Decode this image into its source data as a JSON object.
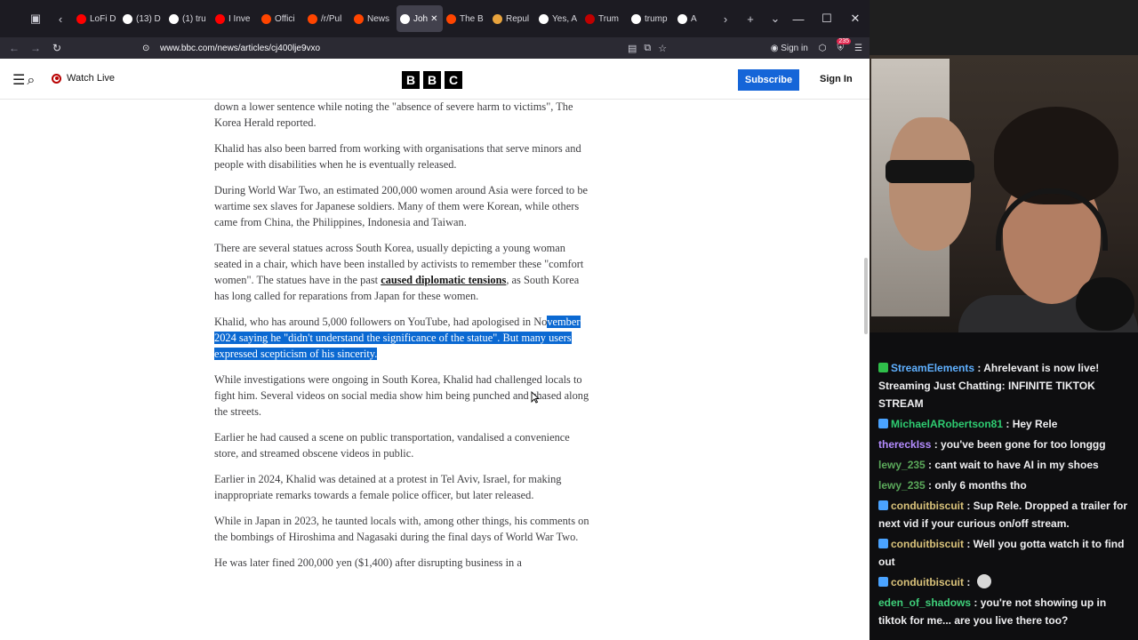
{
  "browser": {
    "tabs": [
      {
        "label": "LoFi D",
        "color": "#ff0000"
      },
      {
        "label": "(13) D",
        "color": "#ffffff"
      },
      {
        "label": "(1) tru",
        "color": "#ffffff"
      },
      {
        "label": "I Inve",
        "color": "#ff0000"
      },
      {
        "label": "Offici",
        "color": "#ff4500"
      },
      {
        "label": "/r/Pul",
        "color": "#ff4500"
      },
      {
        "label": "News",
        "color": "#ff4500"
      },
      {
        "label": "Joh",
        "color": "#ffffff",
        "active": true
      },
      {
        "label": "The B",
        "color": "#ff4500"
      },
      {
        "label": "Repul",
        "color": "#e8a33d"
      },
      {
        "label": "Yes, A",
        "color": "#ffffff"
      },
      {
        "label": "Trum",
        "color": "#c00000"
      },
      {
        "label": "trump",
        "color": "#ffffff"
      },
      {
        "label": "A",
        "color": "#ffffff"
      }
    ],
    "url": "www.bbc.com/news/articles/cj400lje9vxo",
    "signin_label": "Sign in",
    "extension_count": "235"
  },
  "bbc": {
    "watch_live": "Watch Live",
    "logo": [
      "B",
      "B",
      "C"
    ],
    "subscribe": "Subscribe",
    "sign_in": "Sign In"
  },
  "article": {
    "p1": "down a lower sentence while noting the \"absence of severe harm to victims\", The Korea Herald reported.",
    "p2": "Khalid has also been barred from working with organisations that serve minors and people with disabilities when he is eventually released.",
    "p3": "During World War Two, an estimated 200,000 women around Asia were forced to be wartime sex slaves for Japanese soldiers. Many of them were Korean, while others came from China, the Philippines, Indonesia and Taiwan.",
    "p4a": "There are several statues across South Korea, usually depicting a young woman seated in a chair, which have been installed by activists to remember these \"comfort women\". The statues have in the past ",
    "p4link": "caused diplomatic tensions",
    "p4b": ", as South Korea has long called for reparations from Japan for these women.",
    "p5a": "Khalid, who has around 5,000 followers on YouTube, had apologised in No",
    "p5hl": "vember 2024 saying he \"didn't understand the significance of the statue\". But many users expressed scepticism of his sincerity.",
    "p6": "While investigations were ongoing in South Korea, Khalid had challenged locals to fight him. Several videos on social media show him being punched and chased along the streets.",
    "p7": "Earlier he had caused a scene on public transportation, vandalised a convenience store, and streamed obscene videos in public.",
    "p8": "Earlier in 2024, Khalid was detained at a protest in Tel Aviv, Israel, for making inappropriate remarks towards a female police officer, but later released.",
    "p9": "While in Japan in 2023, he taunted locals with, among other things, his comments on the bombings of Hiroshima and Nagasaki during the final days of World War Two.",
    "p10": "He was later fined 200,000 yen ($1,400) after disrupting business in a"
  },
  "chat": [
    {
      "user": "StreamElements",
      "color": "#5fb0ff",
      "text": "Ahrelevant is now live! Streaming Just Chatting: INFINITE TIKTOK STREAM",
      "badge": "#2fbf4a"
    },
    {
      "user": "MichaelARobertson81",
      "color": "#2ecc71",
      "text": "Hey Rele",
      "badge": "#4aa3ff"
    },
    {
      "user": "thereckIss",
      "color": "#b48cff",
      "text": "you've been gone for too longgg",
      "badge": ""
    },
    {
      "user": "lewy_235",
      "color": "#5aa85a",
      "text": "cant wait to have AI in my shoes",
      "badge": ""
    },
    {
      "user": "lewy_235",
      "color": "#5aa85a",
      "text": "only 6 months tho",
      "badge": ""
    },
    {
      "user": "conduitbiscuit",
      "color": "#d9c27a",
      "text": "Sup Rele. Dropped a trailer for next vid if your curious on/off stream.",
      "badge": "#4aa3ff"
    },
    {
      "user": "conduitbiscuit",
      "color": "#d9c27a",
      "text": "Well you gotta watch it to find out",
      "badge": "#4aa3ff"
    },
    {
      "user": "conduitbiscuit",
      "color": "#d9c27a",
      "text": "",
      "badge": "#4aa3ff",
      "emote": true
    },
    {
      "user": "eden_of_shadows",
      "color": "#3fd07a",
      "text": "you're not showing up in tiktok for me... are you live there too?",
      "badge": ""
    }
  ]
}
